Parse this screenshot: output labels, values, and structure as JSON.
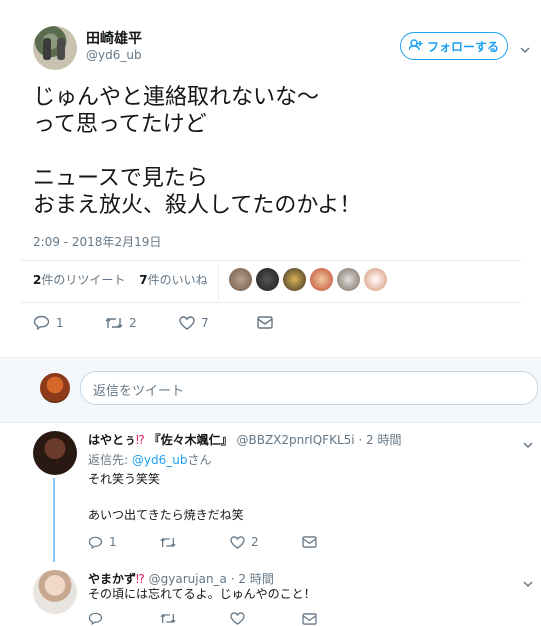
{
  "tweet": {
    "name": "田崎雄平",
    "handle": "@yd6_ub",
    "follow_label": "フォローする",
    "text": "じゅんやと連絡取れないな〜\nって思ってたけど\n\nニュースで見たら\nおまえ放火、殺人してたのかよ！",
    "timestamp": "2:09 - 2018年2月19日",
    "retweets_count": "2",
    "retweets_label": "件のリツイート",
    "likes_count": "7",
    "likes_label": "件のいいね",
    "reply_count": "1",
    "retweet_action_count": "2",
    "like_action_count": "7"
  },
  "reply_box": {
    "placeholder": "返信をツイート"
  },
  "replies": [
    {
      "name": "はやとぅ",
      "name_emoji": "⁉",
      "name_suffix": "『佐々木颯仁』",
      "handle": "@BBZX2pnrIQFKL5i",
      "time": "· 2 時間",
      "reply_to_prefix": "返信先:",
      "reply_to_handle": "@yd6_ub",
      "reply_to_suffix": "さん",
      "text": "それ笑う笑笑\n\nあいつ出てきたら焼きだね笑",
      "reply_count": "1",
      "retweet_count": "",
      "like_count": "2"
    },
    {
      "name": "やまかず",
      "name_emoji": "⁉",
      "handle": "@gyarujan_a",
      "time": "· 2 時間",
      "text": "その頃には忘れてるよ。じゅんやのこと！"
    }
  ],
  "colors": {
    "accent": "#1da1f2",
    "muted": "#657786",
    "thread": "#88c9f9",
    "emoji": "#e0245e"
  }
}
